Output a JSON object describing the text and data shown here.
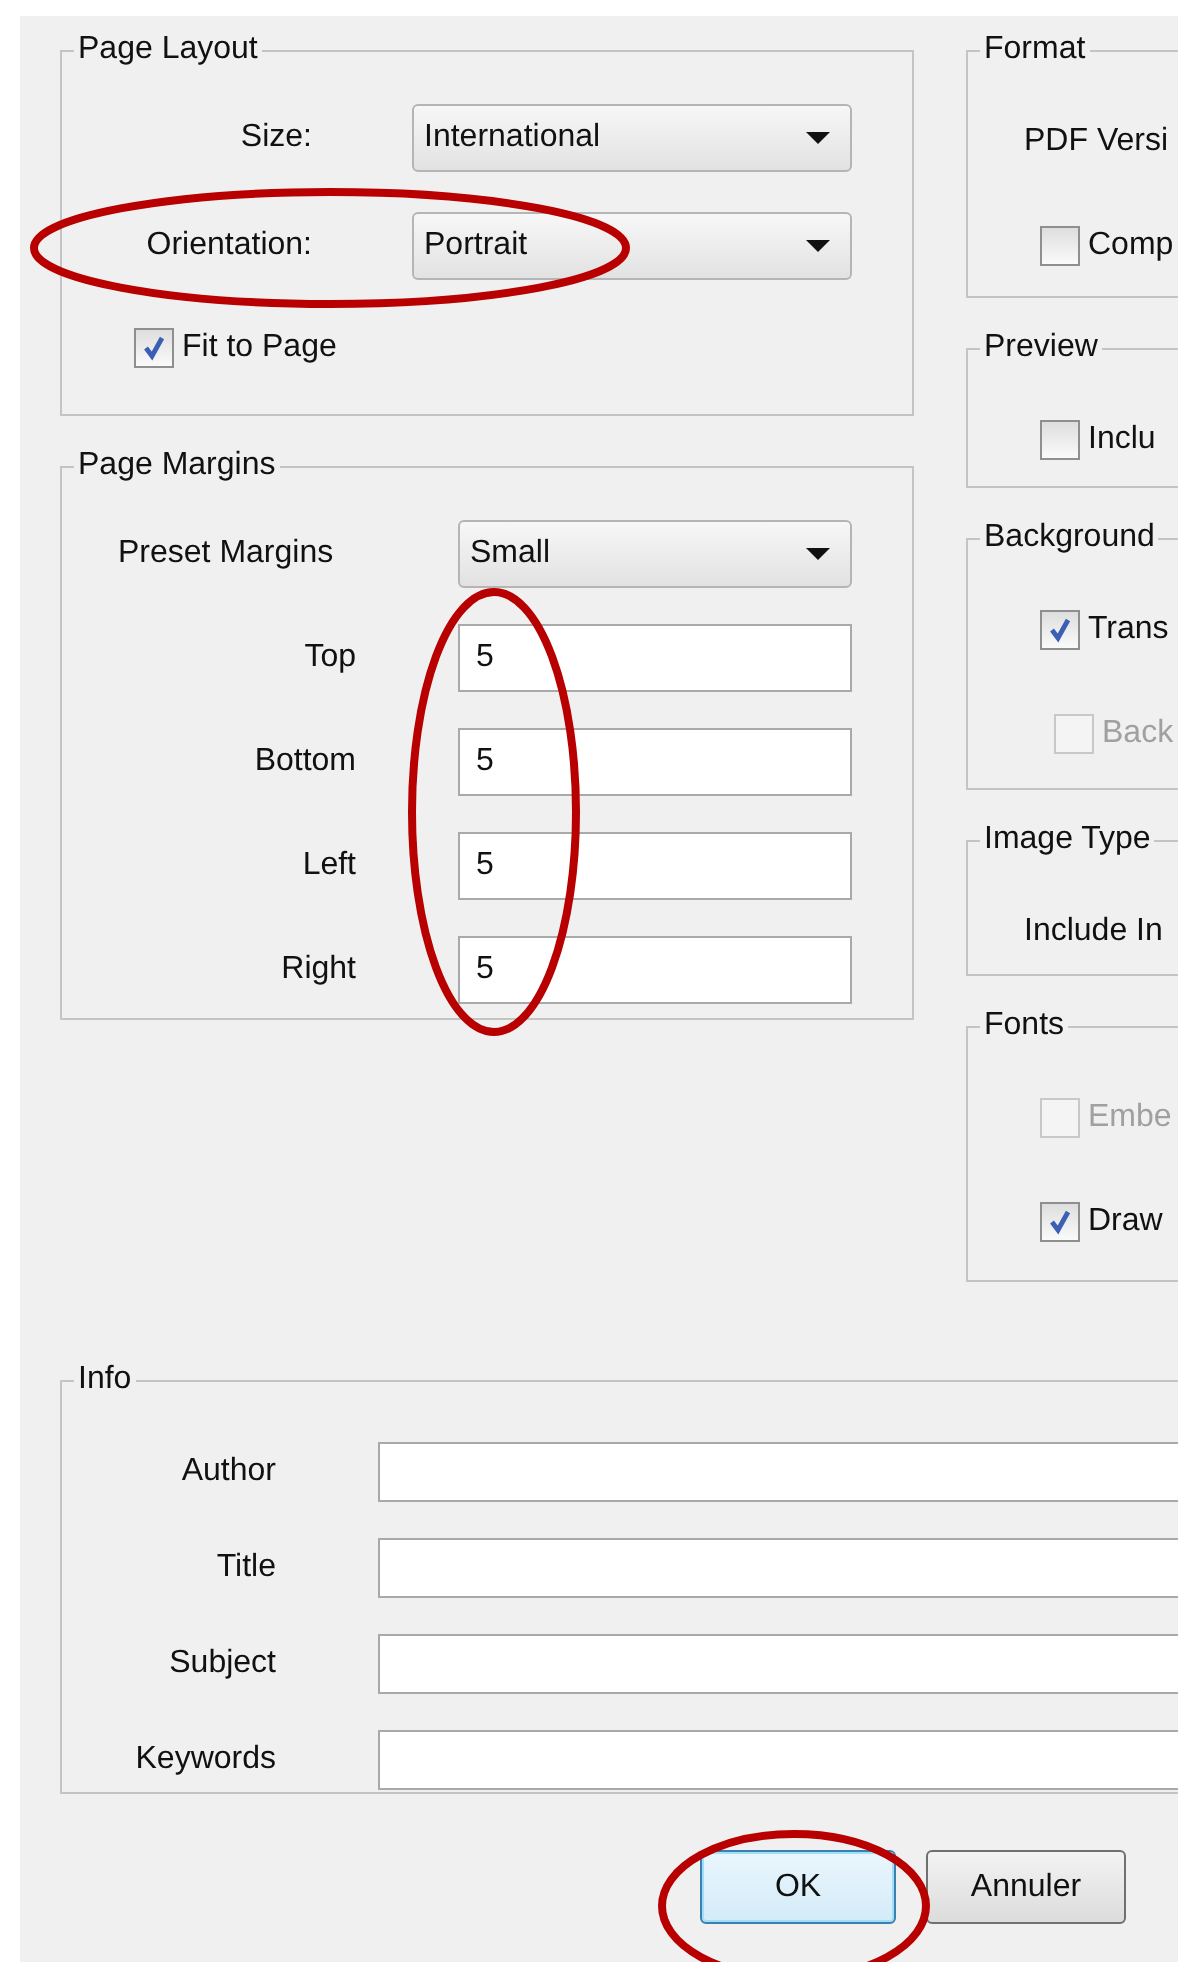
{
  "page_layout": {
    "title": "Page Layout",
    "combos": [
      {
        "label": "Size:",
        "value": "International"
      },
      {
        "label": "Orientation:",
        "value": "Portrait"
      }
    ],
    "options": [
      {
        "label": "Fit to Page",
        "checked": true,
        "disabled": false
      }
    ]
  },
  "page_margins": {
    "title": "Page Margins",
    "preset": {
      "label": "Preset Margins",
      "value": "Small"
    },
    "fields": [
      {
        "label": "Top",
        "value": "5"
      },
      {
        "label": "Bottom",
        "value": "5"
      },
      {
        "label": "Left",
        "value": "5"
      },
      {
        "label": "Right",
        "value": "5"
      }
    ]
  },
  "right_groups": [
    {
      "title": "Format",
      "label": "PDF Versi",
      "options": [
        {
          "label": "Comp",
          "checked": false,
          "disabled": false
        }
      ]
    },
    {
      "title": "Preview",
      "options": [
        {
          "label": "Inclu",
          "checked": false,
          "disabled": false
        }
      ]
    },
    {
      "title": "Background",
      "options": [
        {
          "label": "Trans",
          "checked": true,
          "disabled": false
        },
        {
          "label": "Back",
          "checked": false,
          "disabled": true
        }
      ]
    },
    {
      "title": "Image Type",
      "label": "Include In"
    },
    {
      "title": "Fonts",
      "options": [
        {
          "label": "Embe",
          "checked": false,
          "disabled": true
        },
        {
          "label": "Draw",
          "checked": true,
          "disabled": false
        }
      ]
    }
  ],
  "info": {
    "title": "Info",
    "fields": [
      {
        "label": "Author"
      },
      {
        "label": "Title"
      },
      {
        "label": "Subject"
      },
      {
        "label": "Keywords"
      }
    ]
  },
  "buttons": [
    {
      "label": "OK",
      "default": true
    },
    {
      "label": "Annuler",
      "default": false
    }
  ]
}
